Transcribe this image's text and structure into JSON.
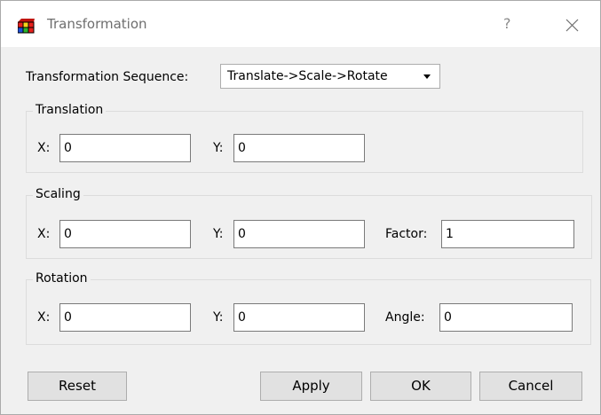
{
  "window": {
    "title": "Transformation",
    "help_label": "?",
    "icon": "cube-app-icon",
    "close_icon": "close-icon"
  },
  "sequence": {
    "label": "Transformation Sequence:",
    "selected": "Translate->Scale->Rotate"
  },
  "translation": {
    "title": "Translation",
    "x_label": "X:",
    "x_value": "0",
    "y_label": "Y:",
    "y_value": "0"
  },
  "scaling": {
    "title": "Scaling",
    "x_label": "X:",
    "x_value": "0",
    "y_label": "Y:",
    "y_value": "0",
    "factor_label": "Factor:",
    "factor_value": "1"
  },
  "rotation": {
    "title": "Rotation",
    "x_label": "X:",
    "x_value": "0",
    "y_label": "Y:",
    "y_value": "0",
    "angle_label": "Angle:",
    "angle_value": "0"
  },
  "buttons": {
    "reset": "Reset",
    "apply": "Apply",
    "ok": "OK",
    "cancel": "Cancel"
  }
}
